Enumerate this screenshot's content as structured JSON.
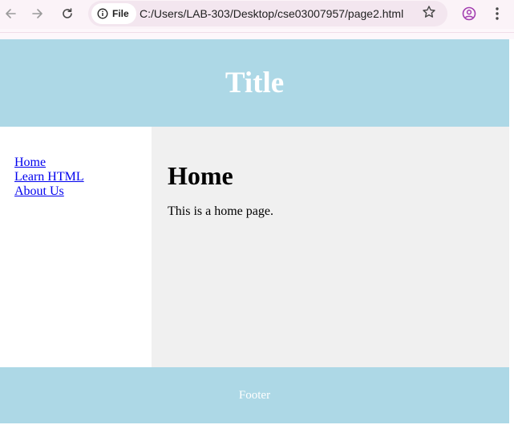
{
  "browser": {
    "site_chip_label": "File",
    "url": "C:/Users/LAB-303/Desktop/cse03007957/page2.html",
    "icons": [
      "back-icon",
      "forward-icon",
      "reload-icon",
      "info-icon",
      "star-icon",
      "profile-icon",
      "menu-icon"
    ]
  },
  "page": {
    "header_title": "Title",
    "nav": [
      {
        "label": "Home"
      },
      {
        "label": "Learn HTML"
      },
      {
        "label": "About Us"
      }
    ],
    "content_heading": "Home",
    "content_text": "This is a home page.",
    "footer_text": "Footer"
  },
  "colors": {
    "header_bg": "#add8e6",
    "footer_bg": "#add8e6",
    "content_bg": "#f0f0f0",
    "link": "#0000ee"
  }
}
